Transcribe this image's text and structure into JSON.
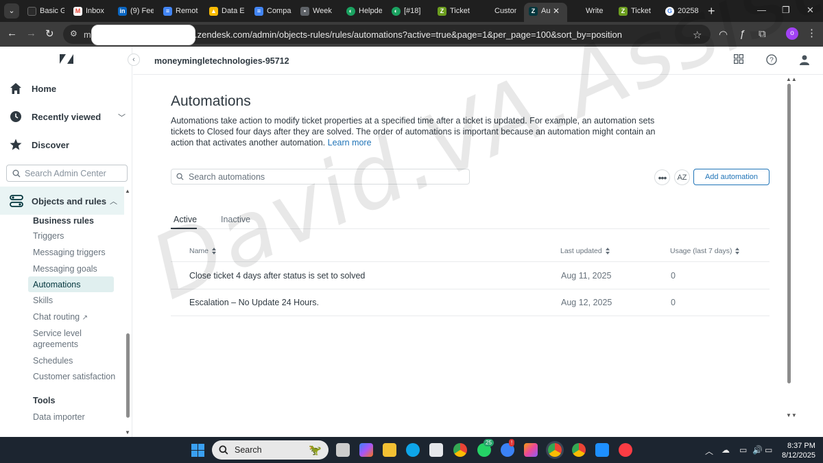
{
  "browser": {
    "tabs": [
      {
        "label": "Basic G",
        "icon": "github-icon",
        "color": "#2b2b2b"
      },
      {
        "label": "Inbox",
        "icon": "gmail-icon",
        "color": "#ea4335"
      },
      {
        "label": "(9) Fee",
        "icon": "linkedin-icon",
        "color": "#0a66c2"
      },
      {
        "label": "Remot",
        "icon": "docs-icon",
        "color": "#4285f4"
      },
      {
        "label": "Data E",
        "icon": "drive-icon",
        "color": "#34a853"
      },
      {
        "label": "Compa",
        "icon": "docs-icon",
        "color": "#4285f4"
      },
      {
        "label": "Week",
        "icon": "slides-icon",
        "color": "#5f6368"
      },
      {
        "label": "Helpde",
        "icon": "freshdesk-icon",
        "color": "#1aa260"
      },
      {
        "label": "[#18]",
        "icon": "freshdesk-icon",
        "color": "#1aa260"
      },
      {
        "label": "Ticket",
        "icon": "zendesk-icon",
        "color": "#6c9e1f"
      },
      {
        "label": "Custon",
        "icon": "blank-icon",
        "color": "#1f1f1f"
      },
      {
        "label": "Au",
        "icon": "zendesk-icon",
        "color": "#03363d"
      },
      {
        "label": "Write",
        "icon": "blank-icon",
        "color": "#1f1f1f"
      },
      {
        "label": "Ticket",
        "icon": "zendesk-icon",
        "color": "#6c9e1f"
      },
      {
        "label": "20258",
        "icon": "google-icon",
        "color": "#ffffff"
      }
    ],
    "url_prefix": "m",
    "url": ".zendesk.com/admin/objects-rules/rules/automations?active=true&page=1&per_page=100&sort_by=position",
    "profile_initial": "o"
  },
  "sidebar": {
    "primary": [
      {
        "label": "Home",
        "icon": "home-icon"
      },
      {
        "label": "Recently viewed",
        "icon": "clock-icon"
      },
      {
        "label": "Discover",
        "icon": "star-icon"
      }
    ],
    "search_placeholder": "Search Admin Center",
    "section": {
      "label": "Objects and rules",
      "icon": "objects-rules-icon"
    },
    "business_rules_heading": "Business rules",
    "business_rules": [
      "Triggers",
      "Messaging triggers",
      "Messaging goals",
      "Automations",
      "Skills",
      "Chat routing"
    ],
    "business_rules_more": [
      "Service level agreements",
      "Schedules",
      "Customer satisfaction"
    ],
    "tools_heading": "Tools",
    "tools": [
      "Data importer"
    ]
  },
  "header": {
    "account": "moneymingletechnologies-95712"
  },
  "main": {
    "title": "Automations",
    "description": "Automations take action to modify ticket properties at a specified time after a ticket is updated. For example, an automation sets tickets to Closed four days after they are solved. The order of automations is important because an automation might contain an action that activates another automation.",
    "learn_more": "Learn more",
    "search_placeholder": "Search automations",
    "add_button": "Add automation",
    "sort_button": "AZ",
    "tabs": {
      "active": "Active",
      "inactive": "Inactive"
    },
    "columns": {
      "name": "Name",
      "last_updated": "Last updated",
      "usage": "Usage (last 7 days)"
    },
    "rows": [
      {
        "name": "Close ticket 4 days after status is set to solved",
        "last_updated": "Aug 11, 2025",
        "usage": "0"
      },
      {
        "name": "Escalation – No Update 24 Hours.",
        "last_updated": "Aug 12, 2025",
        "usage": "0"
      }
    ]
  },
  "watermark": "David.VA.Assist",
  "taskbar": {
    "search_label": "Search",
    "badges": {
      "whatsapp": "25",
      "messenger": "!"
    },
    "time": "8:37 PM",
    "date": "8/12/2025"
  },
  "colors": {
    "accent": "#1f73b7",
    "nav_active": "#e0efef",
    "brand": "#03363d"
  }
}
